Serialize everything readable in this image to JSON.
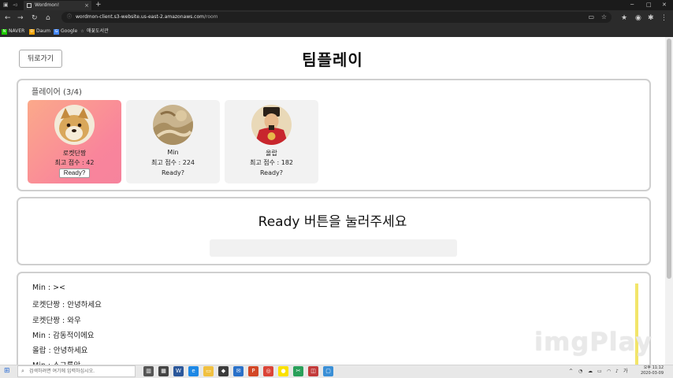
{
  "browser": {
    "tab_title": "Wordmon!",
    "close_tab": "×",
    "new_tab": "+",
    "url_host": "wordmon-client.s3-website.us-east-2.amazonaws.com",
    "url_path": "/room",
    "window_controls": [
      "─",
      "□",
      "✕"
    ],
    "bookmarks": [
      {
        "label": "NAVER",
        "icon": "N",
        "color": "#1ec800"
      },
      {
        "label": "Daum",
        "icon": "D",
        "color": "#f0a30a"
      },
      {
        "label": "Google",
        "icon": "G",
        "color": "#4285f4"
      },
      {
        "label": "애꿎도서관",
        "icon": "☆",
        "color": "#2b2b2b"
      }
    ]
  },
  "page": {
    "back_label": "뒤로가기",
    "title": "팀플레이",
    "players_label": "플레이어 (3/4)",
    "players": [
      {
        "name": "로켓단짱",
        "score": "최고 점수 : 42",
        "ready": "Ready?",
        "avatar": "doge-avatar",
        "highlight": true
      },
      {
        "name": "Min",
        "score": "최고 점수 : 224",
        "ready": "Ready?",
        "avatar": "painting-avatar",
        "highlight": false
      },
      {
        "name": "올랍",
        "score": "최고 점수 : 182",
        "ready": "Ready?",
        "avatar": "king-avatar",
        "highlight": false
      }
    ],
    "status_message": "Ready 버튼을 눌러주세요",
    "chat": [
      "Min : ><",
      "로켓단짱 : 안녕하세요",
      "로켓단짱 : 와우",
      "Min : 감동적이에요",
      "올랍 : 안녕하세요",
      "Min : 소그룹앙"
    ]
  },
  "watermark": "imgPlay",
  "taskbar": {
    "search_placeholder": "검색하려면 여기에 입력하십시오.",
    "ime": "가",
    "time": "오후 11:12",
    "date": "2020-03-09",
    "apps": [
      {
        "icon": "task-view-icon",
        "color": "#555"
      },
      {
        "icon": "calculator-icon",
        "color": "#444"
      },
      {
        "icon": "word-icon",
        "color": "#2b579a"
      },
      {
        "icon": "edge-icon",
        "color": "#1e88e5"
      },
      {
        "icon": "folder-icon",
        "color": "#f0c040"
      },
      {
        "icon": "kakaotalk-icon",
        "color": "#3c3c3c"
      },
      {
        "icon": "mail-icon",
        "color": "#2a71c9"
      },
      {
        "icon": "powerpoint-icon",
        "color": "#d24726"
      },
      {
        "icon": "chrome-icon",
        "color": "#db4437"
      },
      {
        "icon": "chat-icon",
        "color": "#fae100"
      },
      {
        "icon": "snip-icon",
        "color": "#2aa05a"
      },
      {
        "icon": "photo-icon",
        "color": "#c23b3b"
      },
      {
        "icon": "app-icon",
        "color": "#3a8fd6"
      }
    ]
  }
}
